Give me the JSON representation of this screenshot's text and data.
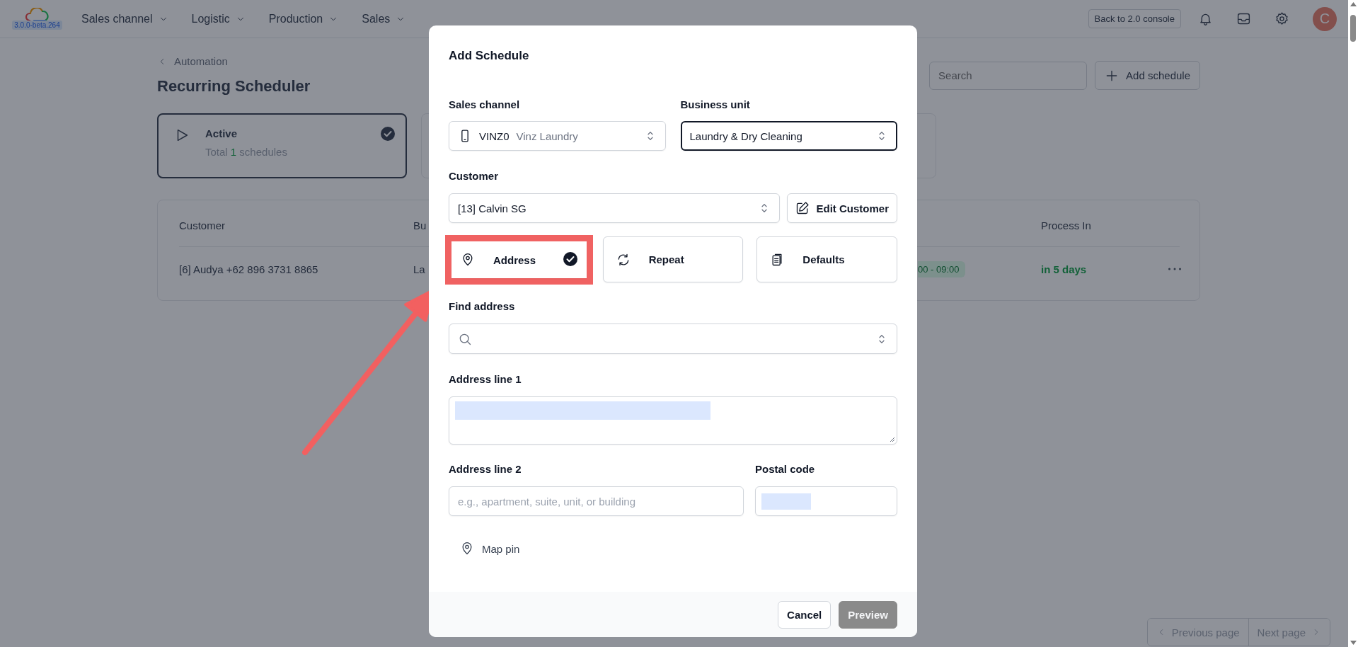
{
  "top_bar": {
    "version": "3.0.0-beta.264",
    "nav": [
      {
        "label": "Sales channel"
      },
      {
        "label": "Logistic"
      },
      {
        "label": "Production"
      },
      {
        "label": "Sales"
      }
    ],
    "console_button": "Back to 2.0 console",
    "avatar": "C"
  },
  "page": {
    "breadcrumb": "Automation",
    "title": "Recurring Scheduler",
    "search": {
      "placeholder": "Search"
    },
    "add_button": "Add schedule",
    "status_cards": [
      {
        "label": "Active",
        "count_before": "Total",
        "count": "1",
        "count_after": "schedules",
        "selected": true
      },
      {
        "selected": false
      }
    ],
    "table": {
      "columns": [
        "Customer",
        "Bu",
        "Process In"
      ],
      "rows": [
        {
          "customer": "[6] Audya +62 896 3731 8865",
          "business_unit": "La",
          "time": "00 - 09:00",
          "process_in": "in 5 days"
        }
      ]
    },
    "pagination": {
      "previous": "Previous page",
      "next": "Next page"
    }
  },
  "dialog": {
    "title": "Add Schedule",
    "sales_channel": {
      "label": "Sales channel",
      "code": "VINZ0",
      "name": "Vinz Laundry"
    },
    "business_unit": {
      "label": "Business unit",
      "value": "Laundry & Dry Cleaning",
      "focused": true
    },
    "customer": {
      "label": "Customer",
      "value": "[13] Calvin SG"
    },
    "edit_customer_button": "Edit Customer",
    "sections": [
      {
        "label": "Address",
        "checked": true
      },
      {
        "label": "Repeat",
        "checked": false
      },
      {
        "label": "Defaults",
        "checked": false
      }
    ],
    "find_address": {
      "label": "Find address"
    },
    "address_line_1": {
      "label": "Address line 1"
    },
    "address_line_2": {
      "label": "Address line 2",
      "placeholder": "e.g., apartment, suite, unit, or building"
    },
    "postal_code": {
      "label": "Postal code"
    },
    "map_pin_button": "Map pin",
    "buttons": [
      {
        "label": "Cancel",
        "kind": "secondary",
        "disabled": false
      },
      {
        "label": "Preview",
        "kind": "primary",
        "disabled": true
      }
    ]
  }
}
